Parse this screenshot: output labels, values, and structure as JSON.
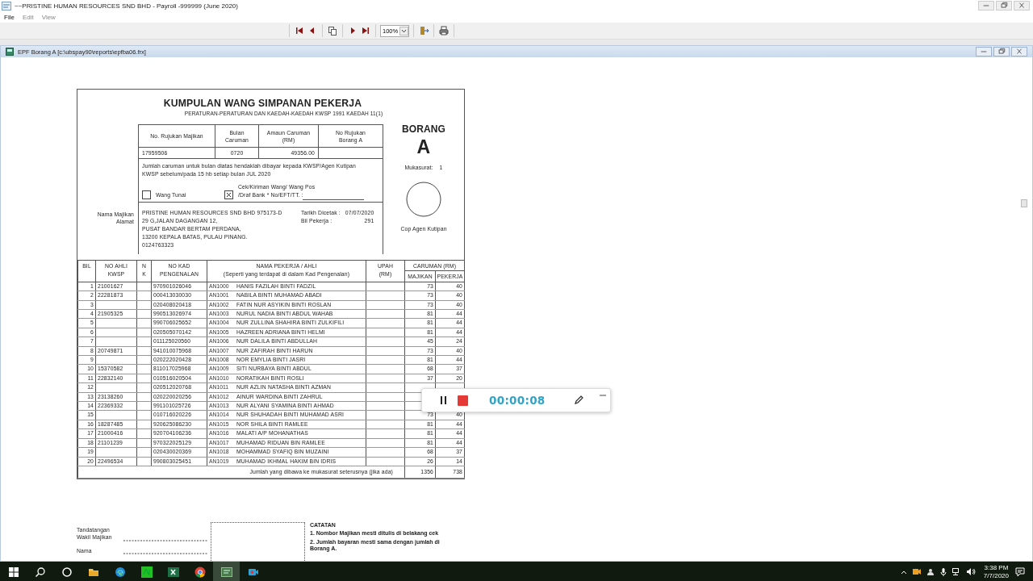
{
  "window": {
    "title": "~~PRISTINE HUMAN RESOURCES SND BHD - Payroll -999999 (June 2020)"
  },
  "menu": [
    {
      "label": "File",
      "disabled": false
    },
    {
      "label": "Edit",
      "disabled": true
    },
    {
      "label": "View",
      "disabled": true
    }
  ],
  "toolbar": {
    "zoom": "100%"
  },
  "report_window": {
    "title": "EPF Borang A [c:\\ubspay90\\reports\\epfba06.frx]"
  },
  "form": {
    "title": "KUMPULAN WANG SIMPANAN PEKERJA",
    "subtitle": "PERATURAN-PERATURAN DAN KAEDAH-KAEDAH KWSP 1991 KAEDAH 11(1)",
    "header_columns": [
      [
        "No. Rujukan Majikan"
      ],
      [
        "Bulan",
        "Caruman"
      ],
      [
        "Amaun Caruman",
        "(RM)"
      ],
      [
        "No Rujukan",
        "Borang A"
      ]
    ],
    "header_values": [
      "17959506",
      "0720",
      "49356.00"
    ],
    "note": "Jumlah caruman untuk bulan diatas hendaklah dibayar kepada KWSP/Agen Kutipan KWSP sebelum/pada 15 hb setiap bulan JUL 2020",
    "payment_options": [
      {
        "label": "Wang Tunai",
        "checked": false
      },
      {
        "label": "Cek/Kiriman Wang/ Wang Pos /Draf Bank * No/EFT/TT. :",
        "checked": true
      }
    ],
    "employer_labels": [
      "Nama Majikan",
      "Alamat"
    ],
    "address": [
      "PRISTINE HUMAN RESOURCES SND BHD 975173-D",
      "29 G,JALAN DAGANGAN 12,",
      "PUSAT BANDAR BERTAM PERDANA,",
      "13200 KEPALA BATAS, PULAU PINANG.",
      "0124763323"
    ],
    "info": [
      {
        "label": "Tarikh Dicetak :",
        "value": "07/07/2020"
      },
      {
        "label": "Bil Pekerja :",
        "value": "291"
      }
    ],
    "borang": "BORANG",
    "letter": "A",
    "page_label": "Mukasurat:",
    "page": "1",
    "stamp_label": "Cop Agen Kutipan"
  },
  "table": {
    "columns": [
      [
        "BIL"
      ],
      [
        "NO AHLI",
        "KWSP"
      ],
      [
        "N",
        "K"
      ],
      [
        "NO KAD",
        "PENGENALAN"
      ],
      [
        "NAMA PEKERJA / AHLI",
        "(Seperti yang terdapat di dalam Kad Pengenalan)"
      ],
      [
        "UPAH",
        "(RM)"
      ]
    ],
    "group": "CARUMAN (RM)",
    "subcolumns": [
      "MAJIKAN",
      "PEKERJA"
    ],
    "rows": [
      {
        "bil": "1",
        "kwsp": "21001627",
        "ic": "970901026046",
        "code": "AN1000",
        "name": "HANIS FAZILAH BINTI FADZIL",
        "majikan": "73",
        "pekerja": "40"
      },
      {
        "bil": "2",
        "kwsp": "22281873",
        "ic": "000413030030",
        "code": "AN1001",
        "name": "NABILA BINTI MUHAMAD ABADI",
        "majikan": "73",
        "pekerja": "40"
      },
      {
        "bil": "3",
        "ic": "020408020418",
        "code": "AN1002",
        "name": "FATIN NUR ASYIKIN BINTI ROSLAN",
        "majikan": "73",
        "pekerja": "40"
      },
      {
        "bil": "4",
        "kwsp": "21905325",
        "ic": "990513026974",
        "code": "AN1003",
        "name": "NURUL NADIA BINTI ABDUL WAHAB",
        "majikan": "81",
        "pekerja": "44"
      },
      {
        "bil": "5",
        "ic": "990706025652",
        "code": "AN1004",
        "name": "NUR ZULLINA SHAHIRA BINTI ZULKIFILI",
        "majikan": "81",
        "pekerja": "44"
      },
      {
        "bil": "6",
        "ic": "020505070142",
        "code": "AN1005",
        "name": "HAZREEN ADRIANA BINTI HELMI",
        "majikan": "81",
        "pekerja": "44"
      },
      {
        "bil": "7",
        "ic": "011125020560",
        "code": "AN1006",
        "name": "NUR DALILA BINTI ABDULLAH",
        "majikan": "45",
        "pekerja": "24"
      },
      {
        "bil": "8",
        "kwsp": "20749871",
        "ic": "941010075968",
        "code": "AN1007",
        "name": "NUR ZAFIRAH BINTI HARUN",
        "majikan": "73",
        "pekerja": "40"
      },
      {
        "bil": "9",
        "ic": "020222020428",
        "code": "AN1008",
        "name": "NOR EMYLIA BINTI JASRI",
        "majikan": "81",
        "pekerja": "44"
      },
      {
        "bil": "10",
        "kwsp": "15370582",
        "ic": "811017025968",
        "code": "AN1009",
        "name": "SITI NURBAYA BINTI ABDUL",
        "majikan": "68",
        "pekerja": "37"
      },
      {
        "bil": "11",
        "kwsp": "22832140",
        "ic": "010516020504",
        "code": "AN1010",
        "name": "NORATIKAH BINTI ROSLI",
        "majikan": "37",
        "pekerja": "20"
      },
      {
        "bil": "12",
        "ic": "020512020768",
        "code": "AN1011",
        "name": "NUR AZLIN NATASHA BINTI AZMAN"
      },
      {
        "bil": "13",
        "kwsp": "23138260",
        "ic": "020220020256",
        "code": "AN1012",
        "name": "AINUR WARDINA BINTI ZAHRUL"
      },
      {
        "bil": "14",
        "kwsp": "22369332",
        "ic": "991101025726",
        "code": "AN1013",
        "name": "NUR ALYANI SYAMINA BINTI AHMAD"
      },
      {
        "bil": "15",
        "ic": "010716020226",
        "code": "AN1014",
        "name": "NUR SHUHADAH BINTI MUHAMAD ASRI",
        "majikan": "73",
        "pekerja": "40"
      },
      {
        "bil": "16",
        "kwsp": "18287485",
        "ic": "920625086230",
        "code": "AN1015",
        "name": "NOR SHILA BINTI RAMLEE",
        "majikan": "81",
        "pekerja": "44"
      },
      {
        "bil": "17",
        "kwsp": "21000416",
        "ic": "920704106236",
        "code": "AN1016",
        "name": "MALATI A/P MOHANATHAS",
        "majikan": "81",
        "pekerja": "44"
      },
      {
        "bil": "18",
        "kwsp": "21101239",
        "ic": "970322025129",
        "code": "AN1017",
        "name": "MUHAMAD RIDUAN BIN RAMLEE",
        "majikan": "81",
        "pekerja": "44"
      },
      {
        "bil": "19",
        "ic": "020430020369",
        "code": "AN1018",
        "name": "MOHAMMAD SYAFIQ BIN MUZAINI",
        "majikan": "68",
        "pekerja": "37"
      },
      {
        "bil": "20",
        "kwsp": "22496534",
        "ic": "990803025451",
        "code": "AN1019",
        "name": "MUHAMAD IKHMAL HAKIM BIN IDRIS",
        "majikan": "26",
        "pekerja": "14"
      }
    ],
    "total_label": "Jumlah yang dibawa ke mukasurat seterusnya (jika ada)",
    "total_majikan": "1356",
    "total_pekerja": "738"
  },
  "footer": {
    "signature_labels": [
      [
        "Tandatangan",
        "Wakil Majikan"
      ],
      [
        "Nama"
      ]
    ],
    "notes_title": "CATATAN",
    "notes": [
      "1. Nombor Majikan mesti ditulis di belakang cek",
      "2. Jumlah bayaran mesti sama dengan jumlah di Borang A."
    ]
  },
  "recorder": {
    "time": "00:00:08"
  },
  "taskbar": {
    "time": "3:38 PM",
    "date": "7/7/2020"
  }
}
